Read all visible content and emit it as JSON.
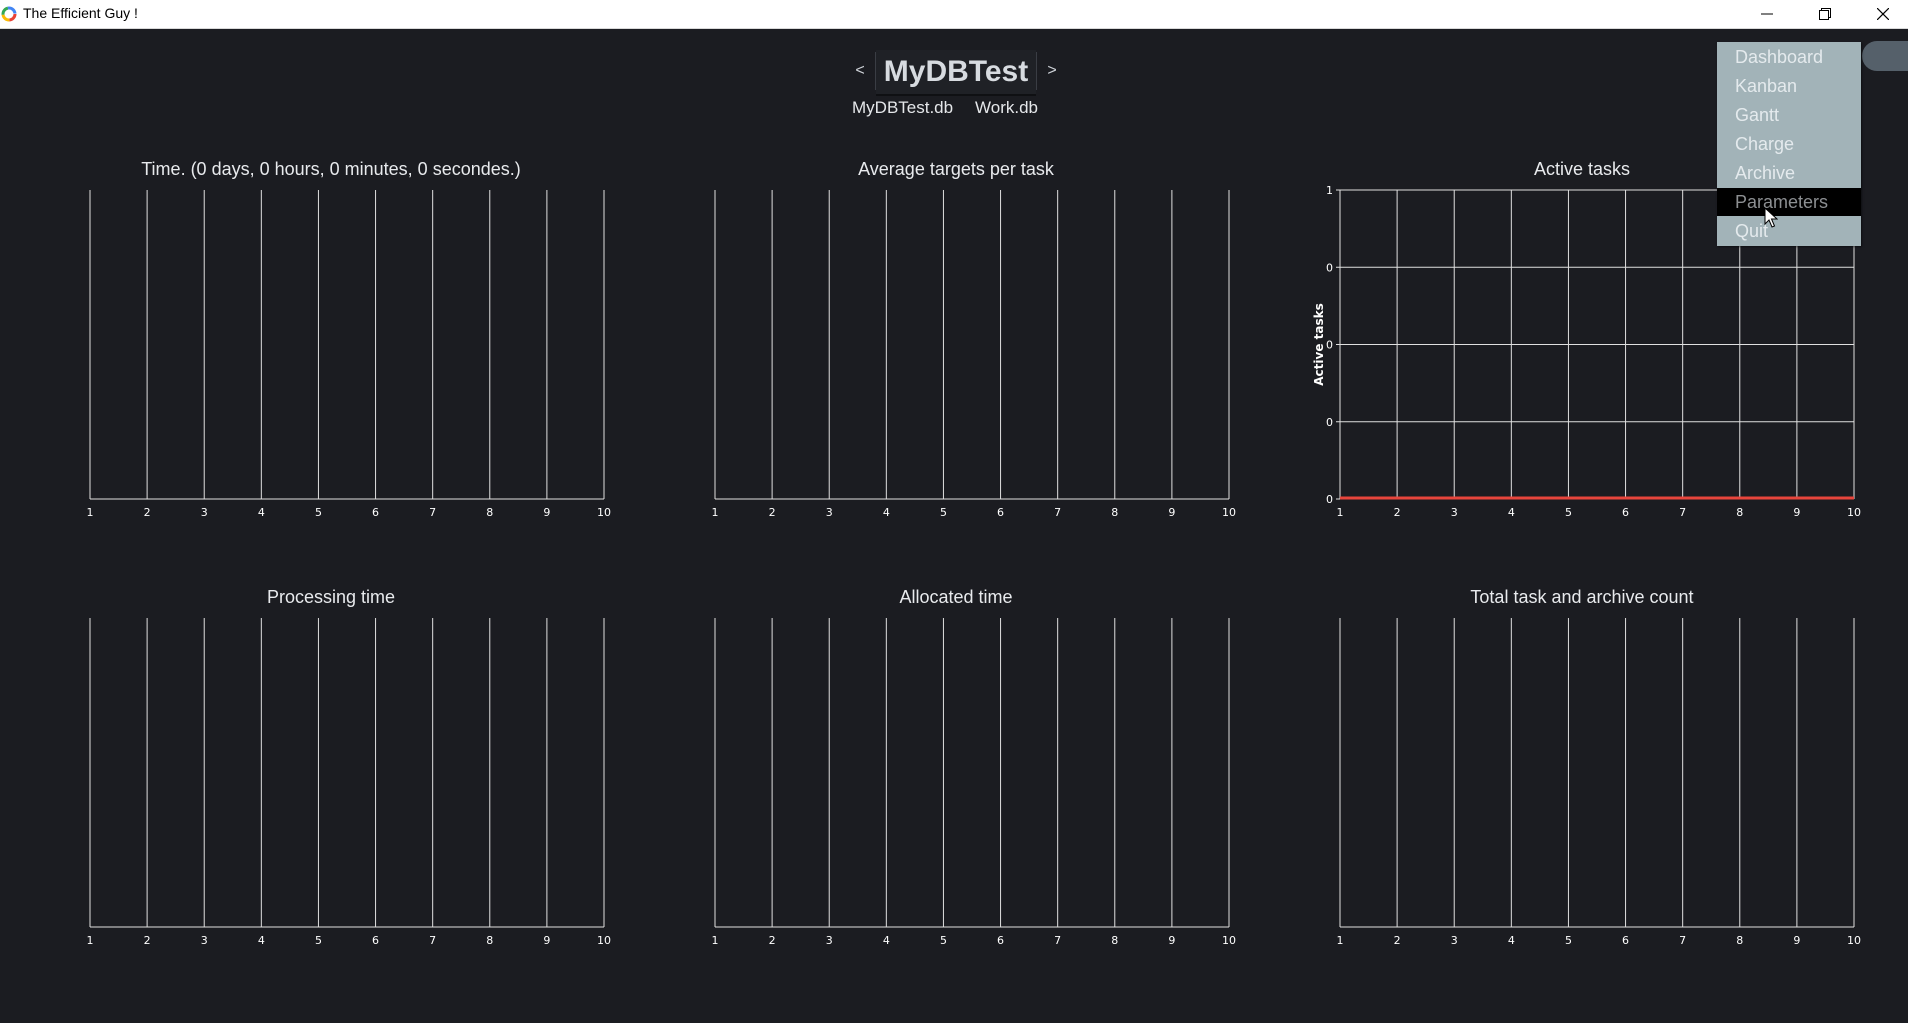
{
  "window": {
    "title": "The Efficient Guy !"
  },
  "header": {
    "prev_label": "<",
    "next_label": ">",
    "current_db": "MyDBTest",
    "db_files": [
      "MyDBTest.db",
      "Work.db"
    ]
  },
  "menu": {
    "items": [
      "Dashboard",
      "Kanban",
      "Gantt",
      "Charge",
      "Archive",
      "Parameters",
      "Quit"
    ],
    "active": "Parameters"
  },
  "colors": {
    "background": "#1b1c21",
    "grid": "#e0e0e0",
    "series": "#e8453c",
    "menu_bg": "#a2b3b8"
  },
  "chart_data": [
    {
      "type": "line",
      "title": "Time. (0 days, 0 hours, 0 minutes, 0 secondes.)",
      "x": [
        1,
        2,
        3,
        4,
        5,
        6,
        7,
        8,
        9,
        10
      ],
      "series": [],
      "grid": "vertical"
    },
    {
      "type": "line",
      "title": "Average targets per task",
      "x": [
        1,
        2,
        3,
        4,
        5,
        6,
        7,
        8,
        9,
        10
      ],
      "series": [],
      "grid": "vertical"
    },
    {
      "type": "line",
      "title": "Active tasks",
      "ylabel": "Active tasks",
      "x": [
        1,
        2,
        3,
        4,
        5,
        6,
        7,
        8,
        9,
        10
      ],
      "y_ticks": [
        "1",
        "0",
        "0",
        "0",
        "0"
      ],
      "series": [
        {
          "values": [
            0,
            0,
            0,
            0,
            0,
            0,
            0,
            0,
            0,
            0
          ]
        }
      ],
      "grid": "both"
    },
    {
      "type": "line",
      "title": "Processing time",
      "x": [
        1,
        2,
        3,
        4,
        5,
        6,
        7,
        8,
        9,
        10
      ],
      "series": [],
      "grid": "vertical"
    },
    {
      "type": "line",
      "title": "Allocated time",
      "x": [
        1,
        2,
        3,
        4,
        5,
        6,
        7,
        8,
        9,
        10
      ],
      "series": [],
      "grid": "vertical"
    },
    {
      "type": "line",
      "title": "Total task and archive count",
      "x": [
        1,
        2,
        3,
        4,
        5,
        6,
        7,
        8,
        9,
        10
      ],
      "series": [],
      "grid": "vertical"
    }
  ]
}
